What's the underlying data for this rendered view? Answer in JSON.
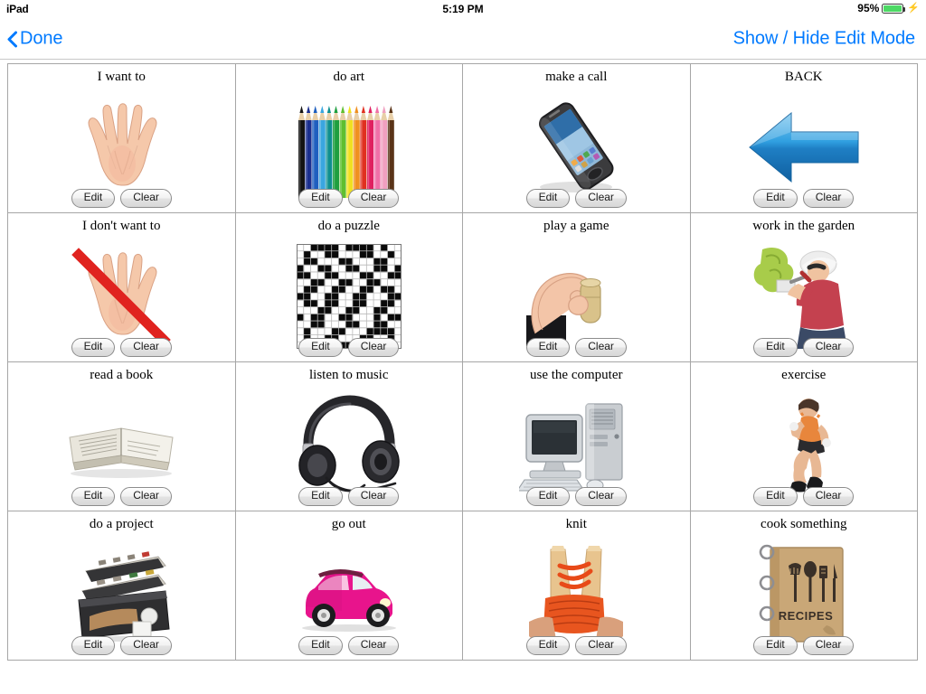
{
  "status_bar": {
    "device": "iPad",
    "time": "5:19 PM",
    "battery_percent": "95%",
    "battery_fill_color": "#4cd964",
    "charging_icon": "⚡"
  },
  "nav_bar": {
    "back_label": "Done",
    "back_icon": "chevron-left-icon",
    "right_label": "Show / Hide Edit Mode",
    "tint_color": "#007aff"
  },
  "buttons": {
    "edit_label": "Edit",
    "clear_label": "Clear"
  },
  "board": {
    "columns": 4,
    "rows": 4,
    "cells": [
      {
        "label": "I want to",
        "art": "open-hands-icon"
      },
      {
        "label": "do art",
        "art": "colored-pencils-icon"
      },
      {
        "label": "make a call",
        "art": "smartphone-icon"
      },
      {
        "label": "BACK",
        "art": "blue-left-arrow-icon"
      },
      {
        "label": "I don't want to",
        "art": "open-hands-crossed-icon"
      },
      {
        "label": "do a puzzle",
        "art": "crossword-grid-icon"
      },
      {
        "label": "play a game",
        "art": "hand-holding-game-piece-icon"
      },
      {
        "label": "work in the garden",
        "art": "gardener-icon"
      },
      {
        "label": "read a book",
        "art": "open-book-icon"
      },
      {
        "label": "listen to music",
        "art": "headphones-icon"
      },
      {
        "label": "use the computer",
        "art": "desktop-computer-icon"
      },
      {
        "label": "exercise",
        "art": "exercising-person-icon"
      },
      {
        "label": "do a project",
        "art": "toolbox-icon"
      },
      {
        "label": "go out",
        "art": "pink-car-icon"
      },
      {
        "label": "knit",
        "art": "knitting-needles-icon"
      },
      {
        "label": "cook something",
        "art": "recipe-book-icon"
      }
    ]
  }
}
